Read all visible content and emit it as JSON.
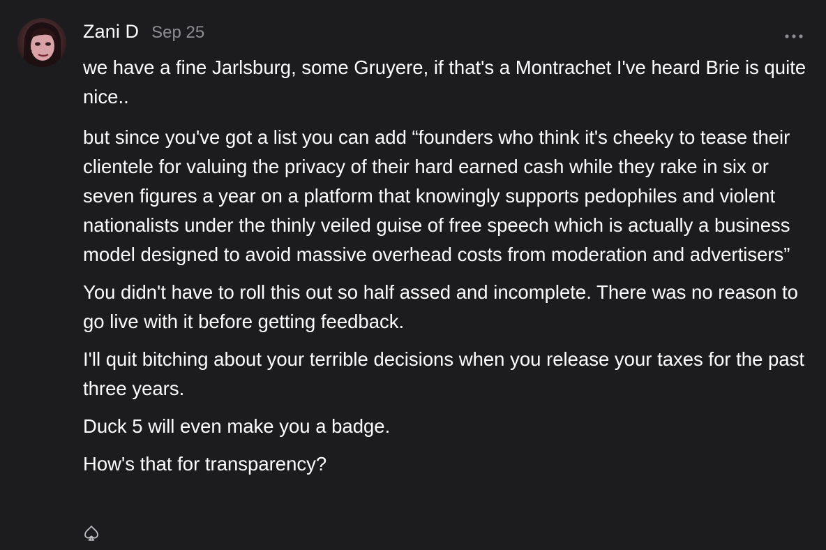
{
  "post": {
    "author": "Zani D",
    "date": "Sep 25",
    "avatar_description": "avatar-photo",
    "more_icon": "ellipsis-icon",
    "like_icon": "spade-outline-icon",
    "paragraphs": [
      "we have a fine Jarlsburg, some Gruyere, if that's a Montrachet I've heard Brie is quite nice..",
      "but since you've got a list you can add “founders who think it's cheeky to tease their clientele for valuing the privacy of their hard earned cash while they rake in six or seven figures a year on a platform that knowingly supports pedophiles and violent nationalists under the thinly veiled guise of free speech which is actually a business model designed to avoid massive overhead costs from moderation and advertisers”",
      "You didn't have to roll this out so half assed and incomplete. There was no reason to go live with it before getting feedback.",
      "I'll quit bitching about your terrible decisions when you release your taxes for the past three years.",
      "Duck 5 will even make you a badge.",
      "How's that for transparency?"
    ]
  },
  "colors": {
    "background": "#1c1c1e",
    "text": "#ffffff",
    "muted": "#8e8e93",
    "icon": "#bdbdc2"
  }
}
